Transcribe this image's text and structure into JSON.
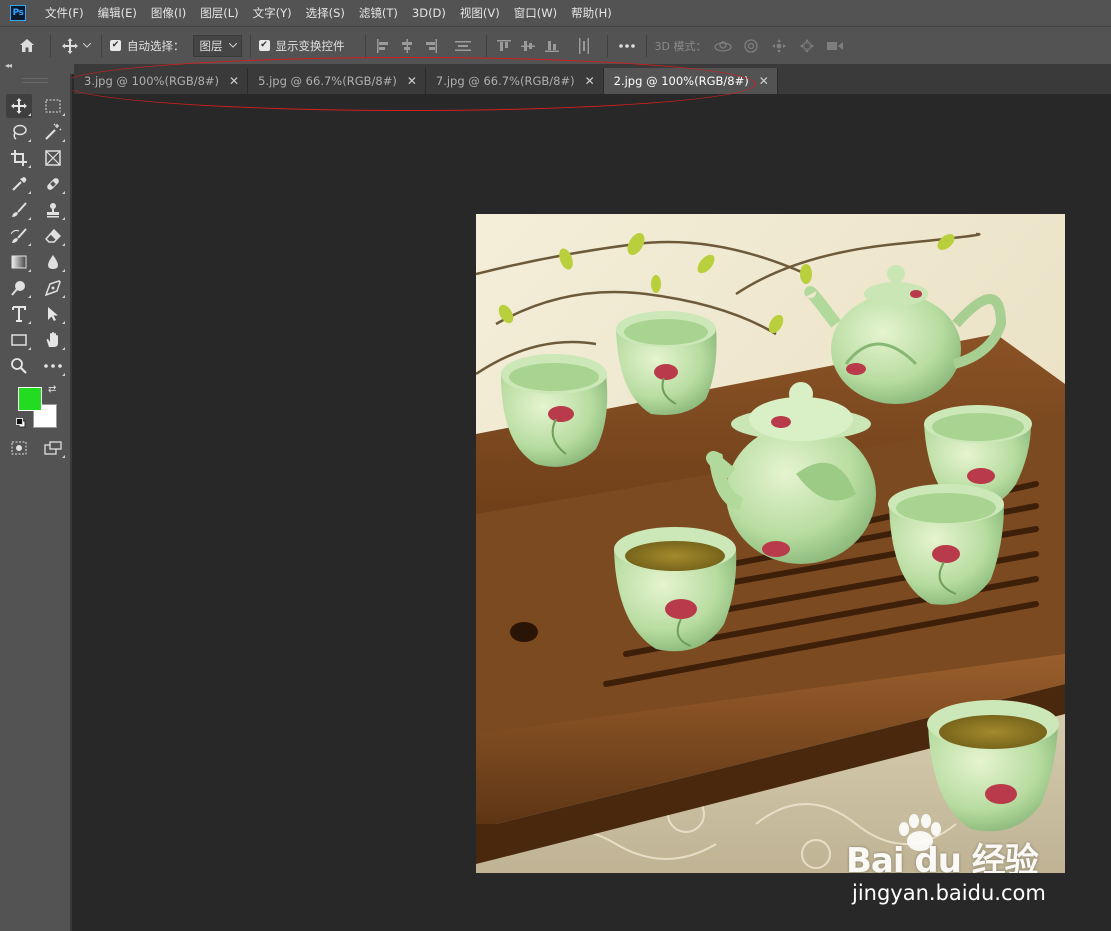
{
  "app": {
    "logo_text": "Ps"
  },
  "menu": [
    "文件(F)",
    "编辑(E)",
    "图像(I)",
    "图层(L)",
    "文字(Y)",
    "选择(S)",
    "滤镜(T)",
    "3D(D)",
    "视图(V)",
    "窗口(W)",
    "帮助(H)"
  ],
  "options": {
    "auto_select_label": "自动选择：",
    "auto_select_value": "图层",
    "show_transform_label": "显示变换控件",
    "mode_label": "3D 模式："
  },
  "tabs": [
    {
      "label": "3.jpg @ 100%(RGB/8#)",
      "active": false
    },
    {
      "label": "5.jpg @ 66.7%(RGB/8#)",
      "active": false
    },
    {
      "label": "7.jpg @ 66.7%(RGB/8#)",
      "active": false
    },
    {
      "label": "2.jpg @ 100%(RGB/8#)",
      "active": true
    }
  ],
  "colors": {
    "foreground": "#22dc22",
    "background": "#ffffff",
    "annotation": "#d21e1e"
  },
  "watermark": {
    "brand": "Bai du 经验",
    "url": "jingyan.baidu.com"
  }
}
